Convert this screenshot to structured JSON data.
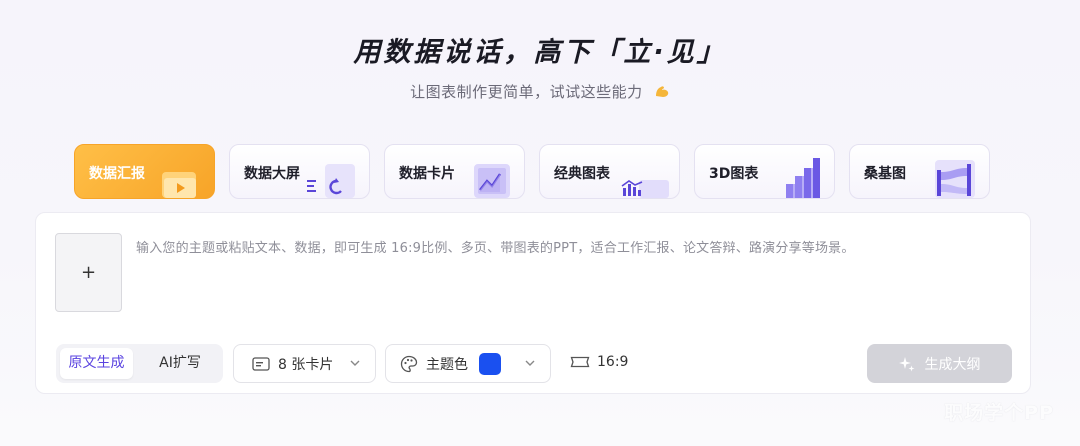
{
  "hero": {
    "title": "用数据说话，高下「立·见」",
    "subtitle": "让图表制作更简单，试试这些能力"
  },
  "tabs": [
    {
      "label": "数据汇报",
      "active": true,
      "icon": "folder-play-icon"
    },
    {
      "label": "数据大屏",
      "active": false,
      "icon": "screen-refresh-icon"
    },
    {
      "label": "数据卡片",
      "active": false,
      "icon": "card-line-chart-icon"
    },
    {
      "label": "经典图表",
      "active": false,
      "icon": "classic-chart-icon"
    },
    {
      "label": "3D图表",
      "active": false,
      "icon": "3d-bar-icon"
    },
    {
      "label": "桑基图",
      "active": false,
      "icon": "sankey-icon"
    }
  ],
  "editor": {
    "upload_label": "+",
    "prompt": "输入您的主题或粘贴文本、数据，即可生成 16:9比例、多页、带图表的PPT，适合工作汇报、论文答辩、路演分享等场景。"
  },
  "mode": {
    "original": "原文生成",
    "ai_expand": "AI扩写"
  },
  "options": {
    "cards_label": "8 张卡片",
    "theme_label": "主题色",
    "theme_color": "#1a50f0",
    "ratio_label": "16:9"
  },
  "generate_label": "生成大纲",
  "watermark": "职场学个PP"
}
